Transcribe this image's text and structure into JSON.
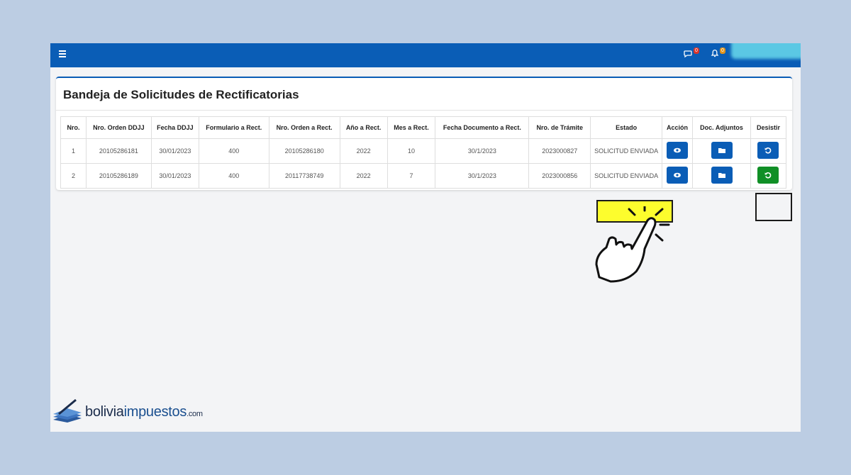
{
  "header": {
    "chat_badge": "0",
    "notif_badge": "0"
  },
  "card": {
    "title": "Bandeja de Solicitudes de Rectificatorias"
  },
  "table": {
    "headers": [
      "Nro.",
      "Nro. Orden DDJJ",
      "Fecha DDJJ",
      "Formulario a Rect.",
      "Nro. Orden a Rect.",
      "Año a Rect.",
      "Mes a Rect.",
      "Fecha Documento a Rect.",
      "Nro. de Trámite",
      "Estado",
      "Acción",
      "Doc. Adjuntos",
      "Desistir"
    ],
    "rows": [
      [
        "1",
        "20105286181",
        "30/01/2023",
        "400",
        "20105286180",
        "2022",
        "10",
        "30/1/2023",
        "2023000827",
        "SOLICITUD ENVIADA"
      ],
      [
        "2",
        "20105286189",
        "30/01/2023",
        "400",
        "20117738749",
        "2022",
        "7",
        "30/1/2023",
        "2023000856",
        "SOLICITUD ENVIADA"
      ]
    ]
  },
  "colors": {
    "primary": "#0a5db6",
    "desistir_active": "#108f26",
    "highlight": "#ffff00",
    "background": "#bccde3"
  },
  "logo": {
    "part1": "bolivia",
    "part2": "impuestos",
    "part3": ".com"
  }
}
